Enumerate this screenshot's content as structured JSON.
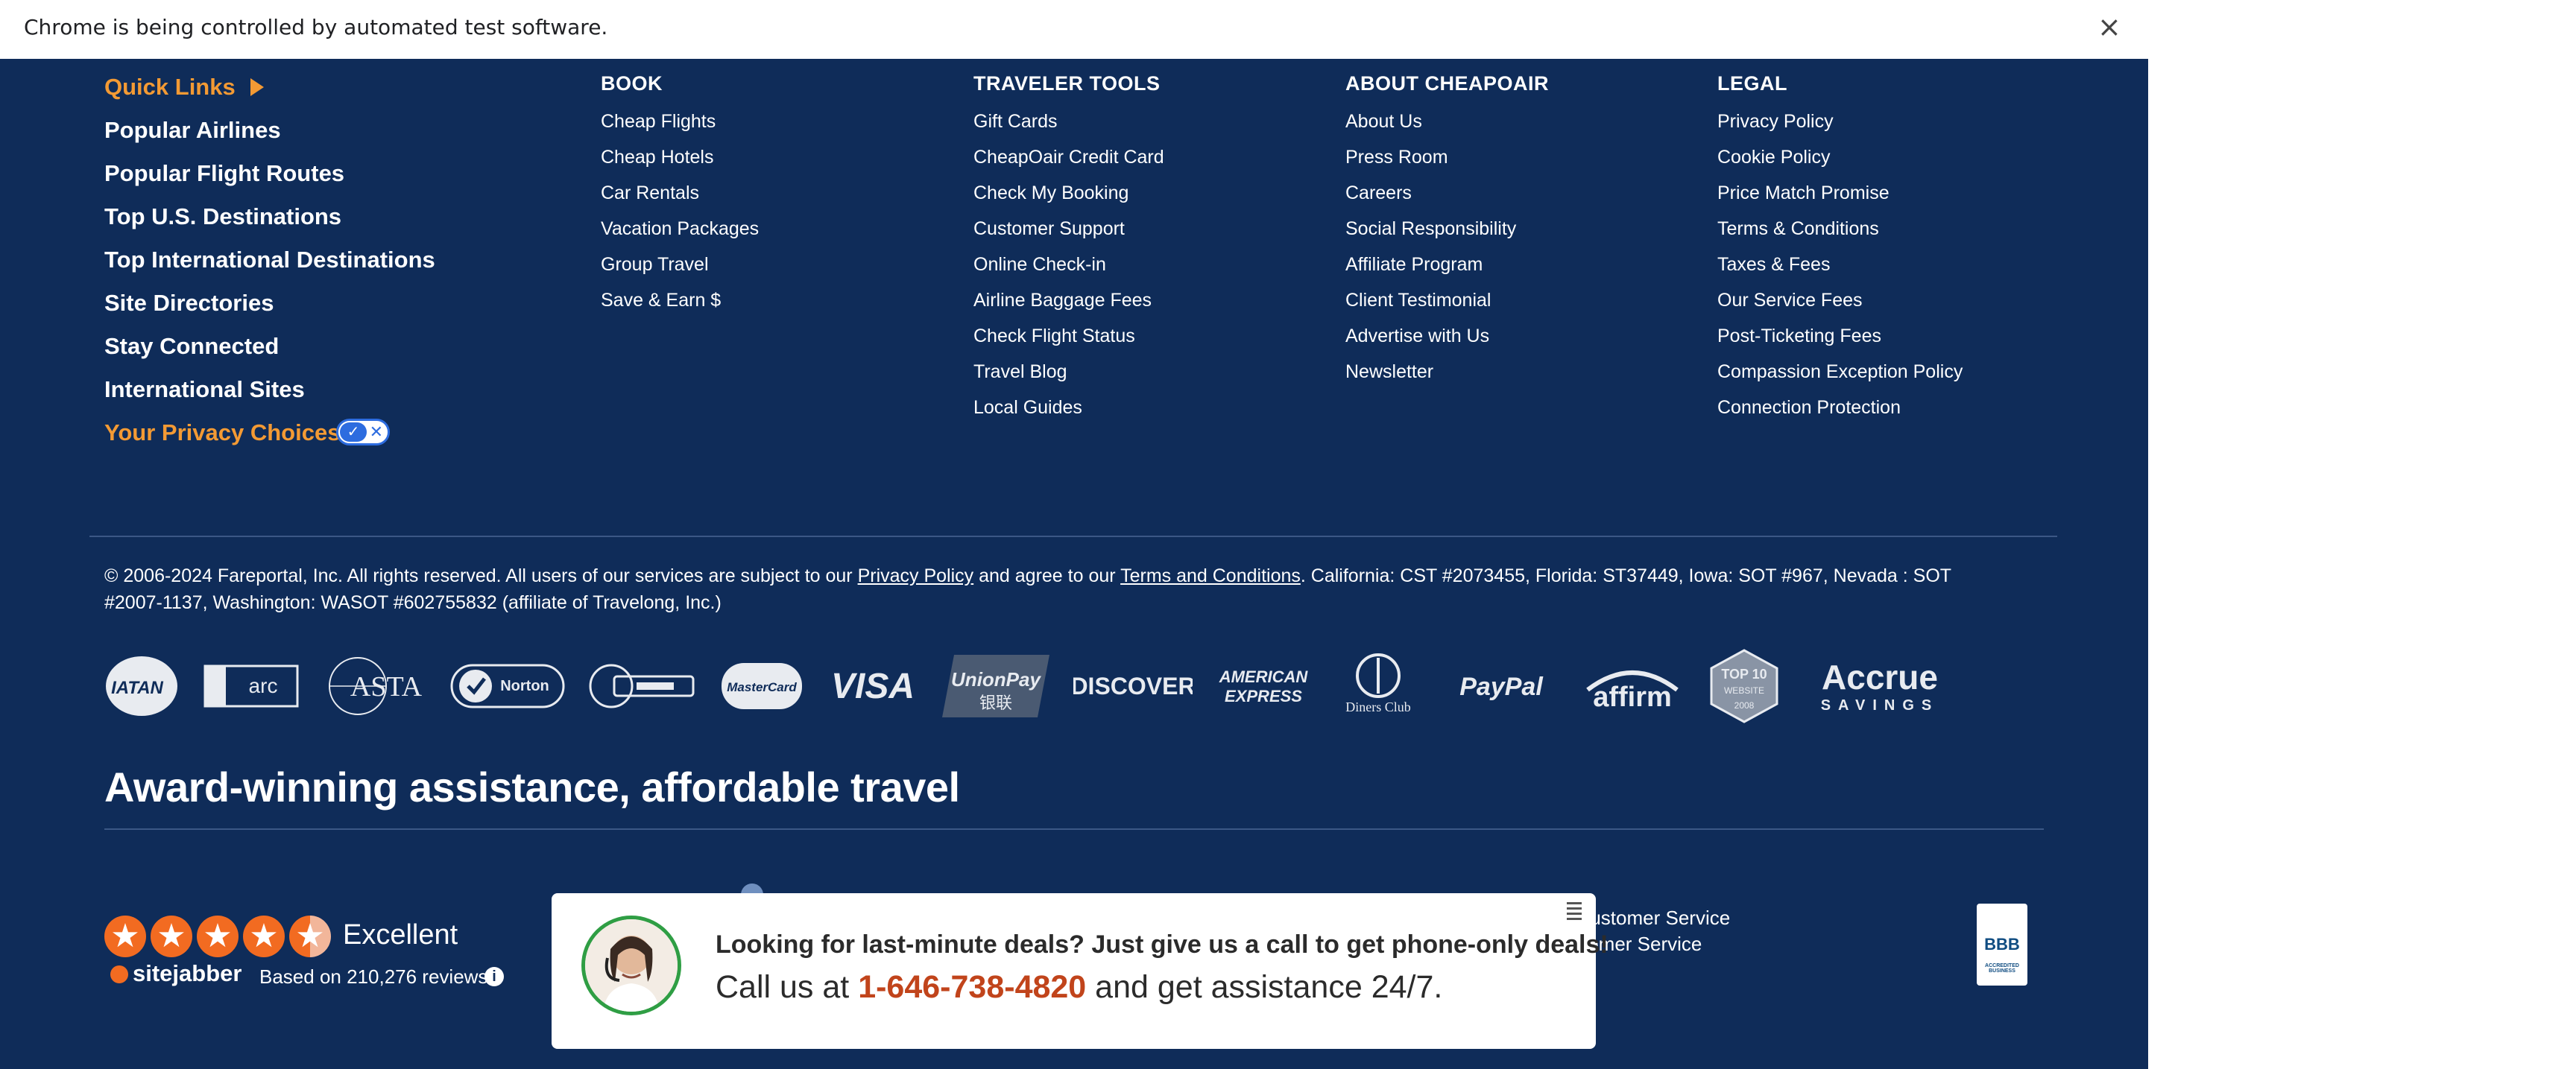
{
  "infobar": {
    "message": "Chrome is being controlled by automated test software.",
    "close_glyph": "×"
  },
  "quick_links": {
    "title": "Quick Links",
    "items": [
      "Popular Airlines",
      "Popular Flight Routes",
      "Top U.S. Destinations",
      "Top International Destinations",
      "Site Directories",
      "Stay Connected",
      "International Sites"
    ],
    "privacy_choices": "Your Privacy Choices"
  },
  "columns": [
    {
      "heading": "BOOK",
      "links": [
        "Cheap Flights",
        "Cheap Hotels",
        "Car Rentals",
        "Vacation Packages",
        "Group Travel",
        "Save & Earn $"
      ]
    },
    {
      "heading": "TRAVELER TOOLS",
      "links": [
        "Gift Cards",
        "CheapOair Credit Card",
        "Check My Booking",
        "Customer Support",
        "Online Check-in",
        "Airline Baggage Fees",
        "Check Flight Status",
        "Travel Blog",
        "Local Guides"
      ]
    },
    {
      "heading": "ABOUT CHEAPOAIR",
      "links": [
        "About Us",
        "Press Room",
        "Careers",
        "Social Responsibility",
        "Affiliate Program",
        "Client Testimonial",
        "Advertise with Us",
        "Newsletter"
      ]
    },
    {
      "heading": "LEGAL",
      "links": [
        "Privacy Policy",
        "Cookie Policy",
        "Price Match Promise",
        "Terms & Conditions",
        "Taxes & Fees",
        "Our Service Fees",
        "Post-Ticketing Fees",
        "Compassion Exception Policy",
        "Connection Protection"
      ]
    }
  ],
  "copyright": {
    "part1": "© 2006-2024 Fareportal, Inc. All rights reserved. All users of our services are subject to our ",
    "privacy_link": "Privacy Policy",
    "part2": " and agree to our ",
    "terms_link": "Terms and Conditions",
    "part3": ". California: CST #2073455, Florida: ST37449, Iowa: SOT #967, Nevada : SOT #2007-1137, Washington: WASOT #602755832 (affiliate of Travelong, Inc.)"
  },
  "logos": [
    {
      "name": "iatan-logo",
      "text": "IATAN"
    },
    {
      "name": "arc-logo",
      "text": "arc"
    },
    {
      "name": "asta-logo",
      "text": "ASTA"
    },
    {
      "name": "norton-logo",
      "text": "Norton"
    },
    {
      "name": "trust-seal-logo",
      "text": ""
    },
    {
      "name": "mastercard-logo",
      "text": "MasterCard"
    },
    {
      "name": "visa-logo",
      "text": "VISA"
    },
    {
      "name": "unionpay-logo",
      "text": "UnionPay"
    },
    {
      "name": "discover-logo",
      "text": "DISCOVER"
    },
    {
      "name": "amex-logo",
      "text": "AMERICAN EXPRESS"
    },
    {
      "name": "diners-club-logo",
      "text": "Diners Club"
    },
    {
      "name": "paypal-logo",
      "text": "PayPal"
    },
    {
      "name": "affirm-logo",
      "text": "affirm"
    },
    {
      "name": "top10-website-logo",
      "text": "TOP 10"
    },
    {
      "name": "accrue-logo",
      "text": "Accrue"
    }
  ],
  "award": {
    "title": "Award-winning assistance, affordable travel"
  },
  "rating": {
    "stars": 4.5,
    "label": "Excellent",
    "brand": "sitejabber",
    "reviews": "Based on 210,276 reviews"
  },
  "customer_service": {
    "line1": "& Customer Service",
    "line2": "stomer Service"
  },
  "bbb": {
    "label": "BBB"
  },
  "popup": {
    "headline": "Looking for last-minute deals? Just give us a call to get phone-only deals!",
    "call_prefix": "Call us at ",
    "phone": "1-646-738-4820",
    "call_suffix": " and get assistance 24/7."
  },
  "colors": {
    "footer_bg": "#0f2c59",
    "accent_orange": "#f39a34",
    "phone_red": "#c1441b",
    "star_orange": "#f26b21"
  }
}
